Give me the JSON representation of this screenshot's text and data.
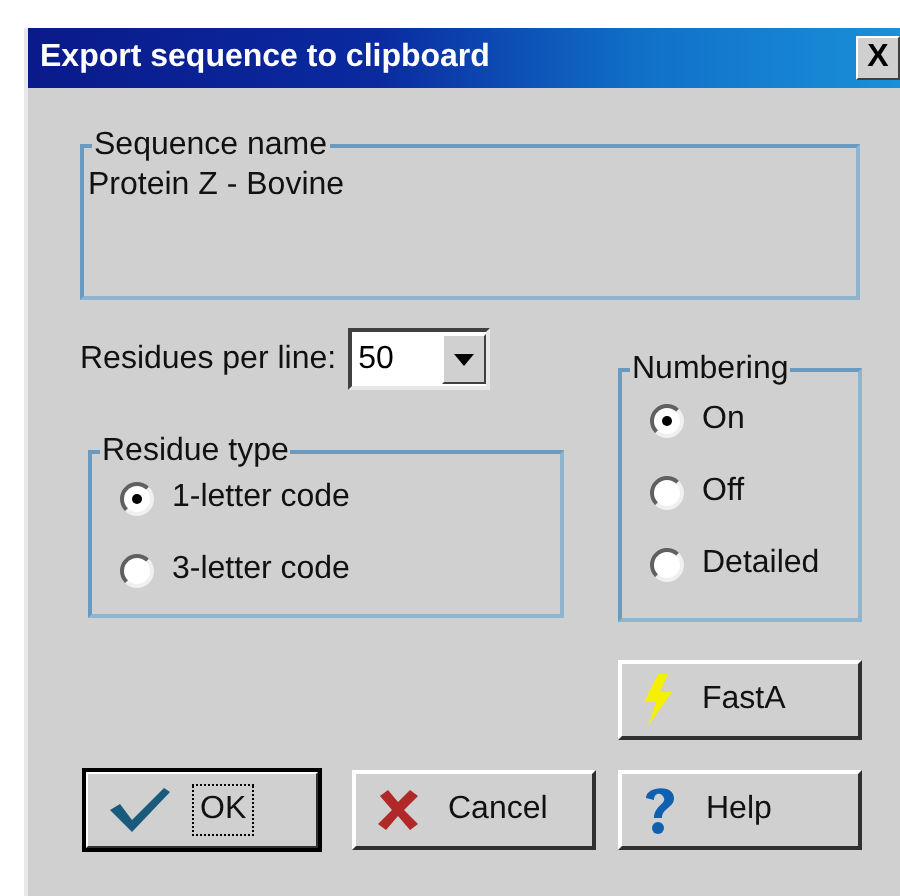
{
  "window": {
    "title": "Export sequence to clipboard",
    "close_label": "X"
  },
  "sequence_name": {
    "legend": "Sequence name",
    "value": "Protein Z - Bovine"
  },
  "residues_per_line": {
    "label": "Residues per line:",
    "value": "50"
  },
  "residue_type": {
    "legend": "Residue type",
    "options": [
      {
        "label": "1-letter code",
        "selected": true
      },
      {
        "label": "3-letter code",
        "selected": false
      }
    ]
  },
  "numbering": {
    "legend": "Numbering",
    "options": [
      {
        "label": "On",
        "selected": true
      },
      {
        "label": "Off",
        "selected": false
      },
      {
        "label": "Detailed",
        "selected": false
      }
    ]
  },
  "buttons": [
    {
      "kind": "fasta",
      "label": "FastA",
      "default": false
    },
    {
      "kind": "ok",
      "label": "OK",
      "default": true
    },
    {
      "kind": "cancel",
      "label": "Cancel",
      "default": false
    },
    {
      "kind": "help",
      "label": "Help",
      "default": false
    }
  ]
}
